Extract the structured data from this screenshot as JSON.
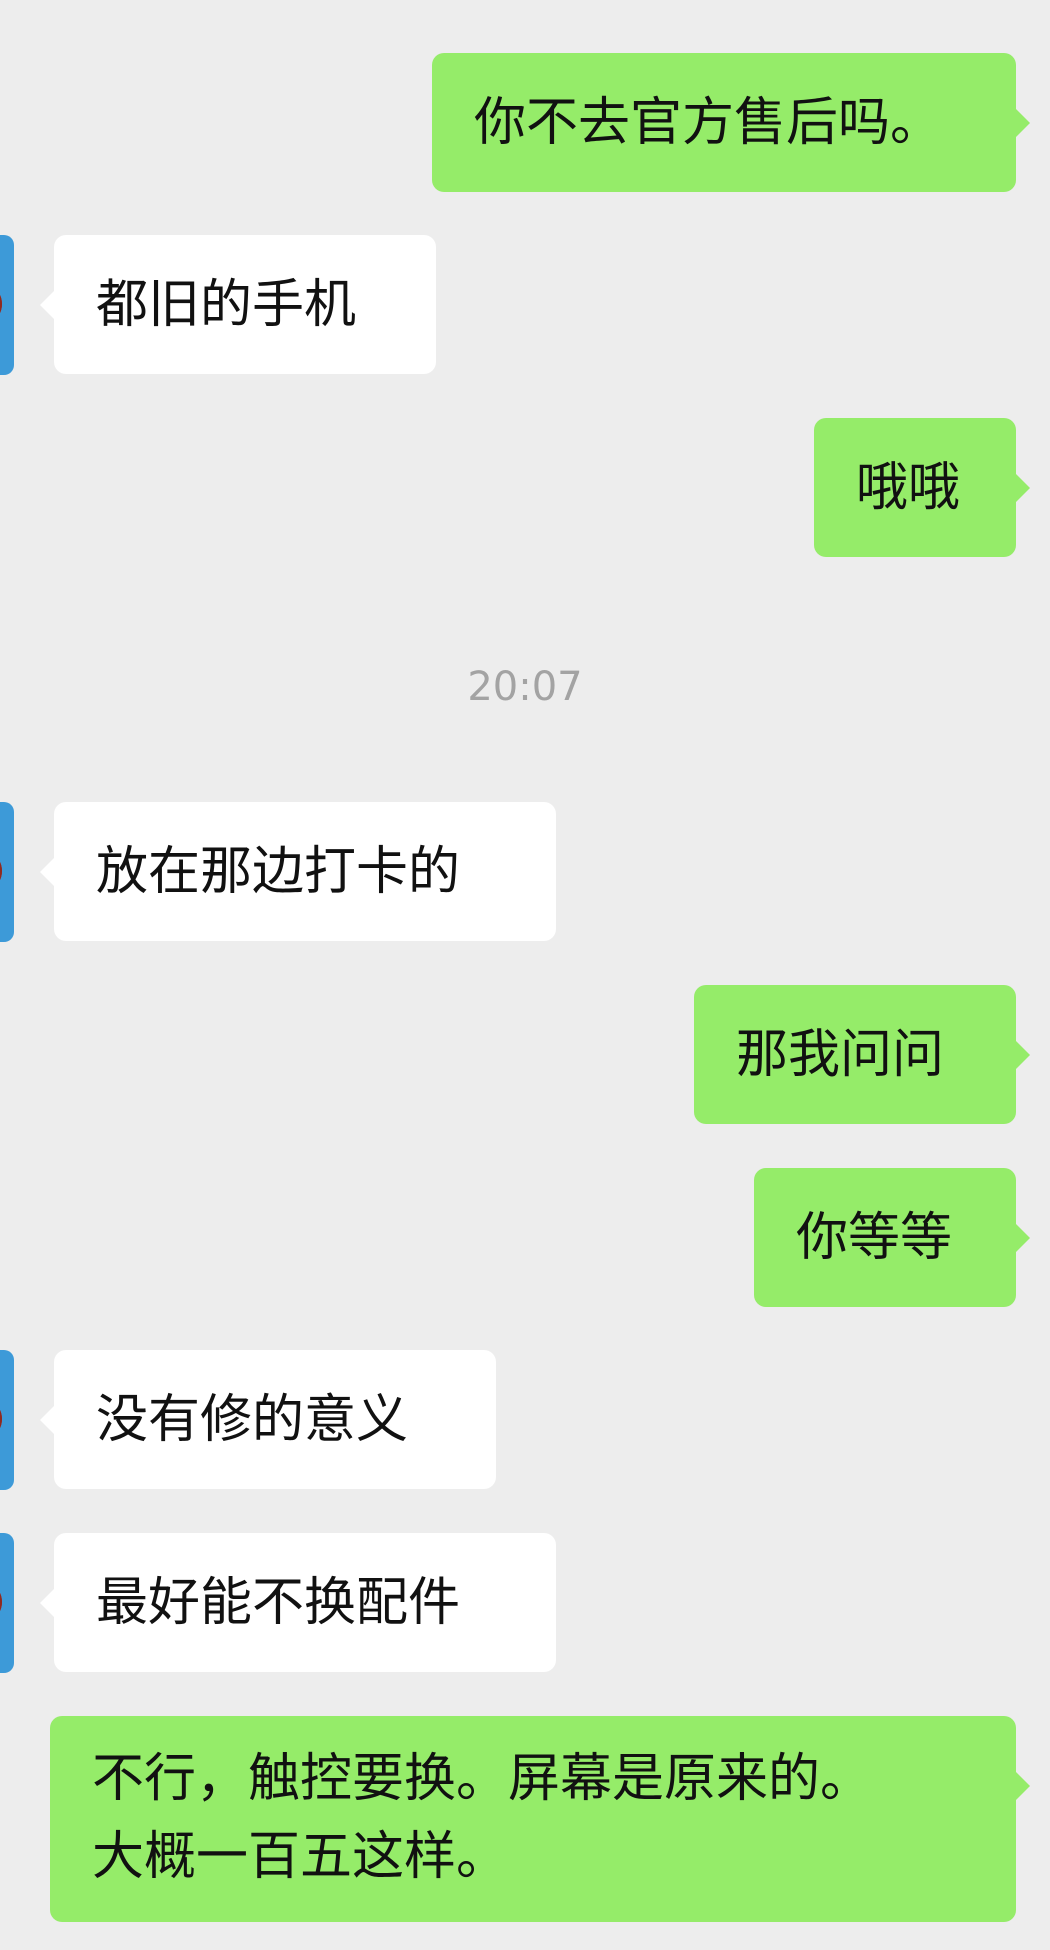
{
  "messages": [
    {
      "side": "out",
      "text": "你不去官方售后吗。"
    },
    {
      "side": "in",
      "text": "都旧的手机"
    },
    {
      "side": "out",
      "text": "哦哦"
    },
    {
      "timestamp": "20:07"
    },
    {
      "side": "in",
      "text": "放在那边打卡的"
    },
    {
      "side": "out",
      "text": "那我问问"
    },
    {
      "side": "out",
      "text": "你等等"
    },
    {
      "side": "in",
      "text": "没有修的意义"
    },
    {
      "side": "in",
      "text": "最好能不换配件"
    },
    {
      "side": "out",
      "lines": [
        "不行，触控要换。屏幕是原来的。",
        "大概一百五这样。"
      ]
    }
  ],
  "colors": {
    "background": "#ededed",
    "outgoing_bubble": "#95ec69",
    "incoming_bubble": "#ffffff",
    "avatar": "#3d9ad8"
  }
}
